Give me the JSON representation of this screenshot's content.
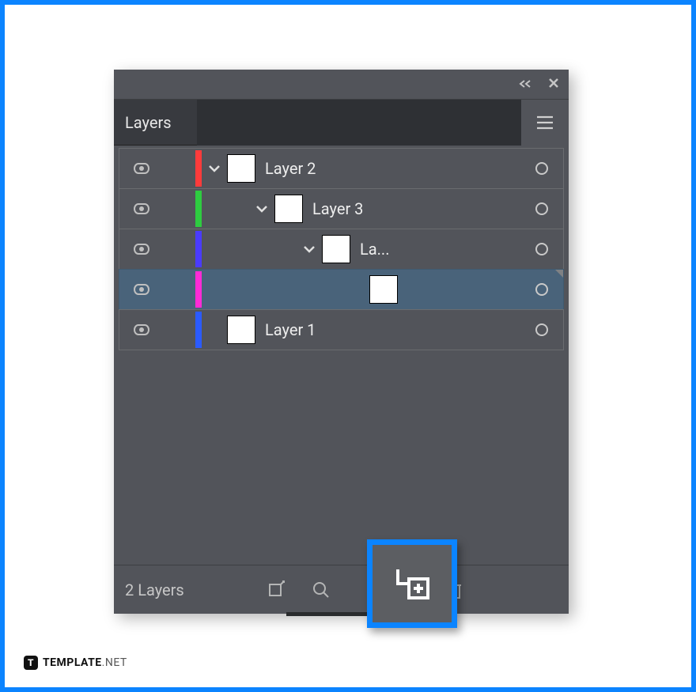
{
  "panel": {
    "tabLabel": "Layers",
    "footer": {
      "countLabel": "2 Layers"
    }
  },
  "layers": [
    {
      "name": "Layer 2",
      "indent": 0,
      "color": "#ff3b3b",
      "expanded": true,
      "hasChildren": true,
      "selected": false,
      "showTarget": true
    },
    {
      "name": "Layer 3",
      "indent": 1,
      "color": "#2ecc40",
      "expanded": true,
      "hasChildren": true,
      "selected": false,
      "showTarget": true
    },
    {
      "name": "La...",
      "indent": 2,
      "color": "#4a3bff",
      "expanded": true,
      "hasChildren": true,
      "selected": false,
      "showTarget": true
    },
    {
      "name": "",
      "indent": 3,
      "color": "#ff2bd6",
      "expanded": false,
      "hasChildren": false,
      "selected": true,
      "showTarget": true
    },
    {
      "name": "Layer 1",
      "indent": 0,
      "color": "#2b5bff",
      "expanded": false,
      "hasChildren": false,
      "selected": false,
      "showTarget": true
    }
  ],
  "footerIcons": [
    {
      "id": "collect-for-export-icon"
    },
    {
      "id": "locate-object-icon"
    },
    {
      "id": "new-sublayer-icon"
    },
    {
      "id": "new-layer-icon"
    },
    {
      "id": "delete-icon"
    }
  ],
  "titlebarIcons": [
    {
      "id": "collapse-panel-icon"
    },
    {
      "id": "close-panel-icon"
    }
  ],
  "brand": {
    "main": "TEMPLATE",
    "suffix": ".NET"
  },
  "highlightedAction": "new-sublayer-icon"
}
